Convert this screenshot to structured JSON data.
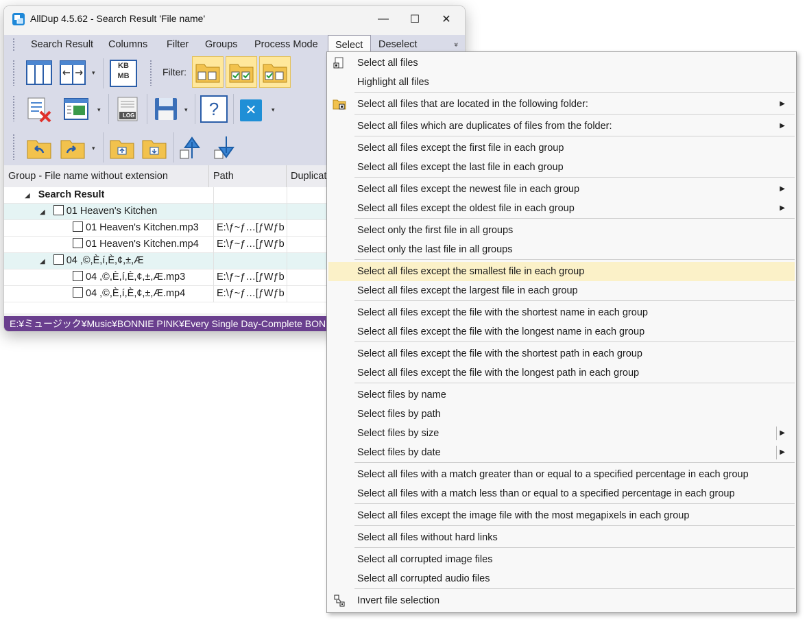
{
  "window": {
    "title": "AllDup 4.5.62 - Search Result 'File name'",
    "controls": {
      "minimize": "—",
      "maximize": "☐",
      "close": "✕"
    }
  },
  "menubar": {
    "items": [
      "Search Result",
      "Columns",
      "Filter",
      "Groups",
      "Process Mode",
      "Select",
      "Deselect"
    ],
    "active": "Select",
    "overflow": "»"
  },
  "toolbar": {
    "filter_label": "Filter:",
    "kb_mb_top": "KB",
    "kb_mb_bottom": "MB",
    "log_label": "LOG",
    "help_symbol": "?",
    "close_symbol": "✕",
    "drop_arrow": "▾"
  },
  "grid": {
    "columns": [
      "Group - File name without extension",
      "Path",
      "Duplicat"
    ],
    "root": {
      "label": "Search Result",
      "expander": "◢"
    },
    "groups": [
      {
        "label": "01 Heaven's Kitchen",
        "expander": "◢",
        "files": [
          {
            "name": "01 Heaven's Kitchen.mp3",
            "path": "E:\\ƒ~ƒ…[ƒWƒb"
          },
          {
            "name": "01 Heaven's Kitchen.mp4",
            "path": "E:\\ƒ~ƒ…[ƒWƒb"
          }
        ]
      },
      {
        "label": "04 ,©,È,í,È,¢,±,Æ",
        "expander": "◢",
        "files": [
          {
            "name": "04 ,©,È,í,È,¢,±,Æ.mp3",
            "path": "E:\\ƒ~ƒ…[ƒWƒb"
          },
          {
            "name": "04 ,©,È,í,È,¢,±,Æ.mp4",
            "path": "E:\\ƒ~ƒ…[ƒWƒb"
          }
        ]
      }
    ]
  },
  "statusbar": {
    "text": "E:¥ミュージック¥Music¥BONNIE PINK¥Every Single Day-Complete BONNIE PINK (1995-2006)"
  },
  "select_menu": {
    "highlighted_index": 11,
    "items": [
      {
        "label": "Select all files",
        "icon": "select-page-icon"
      },
      {
        "label": "Highlight all files"
      },
      {
        "label": "Select all files that are located in the following folder:",
        "icon": "folder-select-icon",
        "submenu": true
      },
      {
        "label": "Select all files which are duplicates of files from the folder:",
        "submenu": true
      },
      {
        "label": "Select all files except the first file in each group"
      },
      {
        "label": "Select all files except the last file in each group"
      },
      {
        "label": "Select all files except the newest file in each group",
        "submenu": true
      },
      {
        "label": "Select all files except the oldest file in each group",
        "submenu": true
      },
      {
        "label": "Select only the first file in all groups"
      },
      {
        "label": "Select only the last file in all groups"
      },
      {
        "label": "Select all files except the smallest file in each group"
      },
      {
        "label": "Select all files except the largest file in each group"
      },
      {
        "label": "Select all files except the file with the shortest name in each group"
      },
      {
        "label": "Select all files except the file with the longest name in each group"
      },
      {
        "label": "Select all files except the file with the shortest path in each group"
      },
      {
        "label": "Select all files except the file with the longest path in each group"
      },
      {
        "label": "Select files by name"
      },
      {
        "label": "Select files by path"
      },
      {
        "label": "Select files by size",
        "split_submenu": true
      },
      {
        "label": "Select files by date",
        "split_submenu": true
      },
      {
        "label": "Select all files with a match greater than or equal to a specified percentage in each group"
      },
      {
        "label": "Select all files with a match less than or equal to a specified percentage in each group"
      },
      {
        "label": "Select all files except the image file with the most megapixels in each group"
      },
      {
        "label": "Select all files without hard links"
      },
      {
        "label": "Select all corrupted image files"
      },
      {
        "label": "Select all corrupted audio files"
      },
      {
        "label": "Invert file selection",
        "icon": "invert-selection-icon"
      }
    ],
    "arrow": "▶"
  }
}
